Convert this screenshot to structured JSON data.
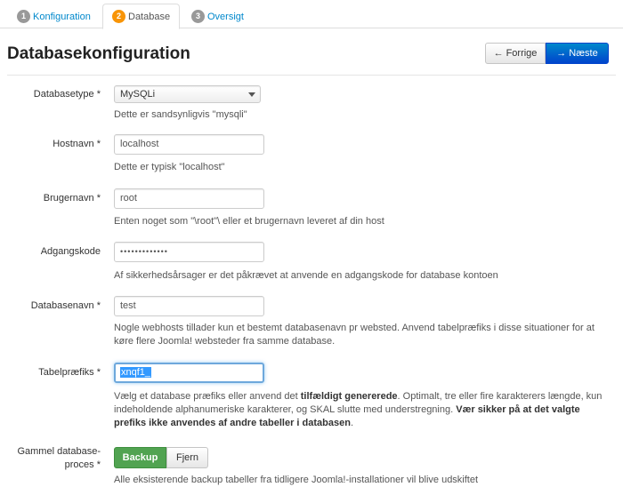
{
  "tabs": [
    {
      "num": "1",
      "label": "Konfiguration"
    },
    {
      "num": "2",
      "label": "Database"
    },
    {
      "num": "3",
      "label": "Oversigt"
    }
  ],
  "header": {
    "title": "Databasekonfiguration",
    "prev_label": "Forrige",
    "next_label": "Næste",
    "prev_icon": "←",
    "next_icon": "→"
  },
  "form": {
    "db_type": {
      "label": "Databasetype *",
      "value": "MySQLi",
      "help": "Dette er sandsynligvis \"mysqli\""
    },
    "host": {
      "label": "Hostnavn *",
      "value": "localhost",
      "help": "Dette er typisk \"localhost\""
    },
    "user": {
      "label": "Brugernavn *",
      "value": "root",
      "help": "Enten noget som \"\\root\"\\ eller et brugernavn leveret af din host"
    },
    "password": {
      "label": "Adgangskode",
      "value": "•••••••••••••",
      "help": "Af sikkerhedsårsager er det påkrævet at anvende en adgangskode for database kontoen"
    },
    "db_name": {
      "label": "Databasenavn *",
      "value": "test",
      "help_line1": "Nogle webhosts tillader kun et bestemt databasenavn pr websted. Anvend tabelpræfiks i disse situationer for at",
      "help_line2": "køre flere Joomla! websteder fra samme database."
    },
    "prefix": {
      "label": "Tabelpræfiks *",
      "value": "xnqf1_",
      "help_a": "Vælg et database præfiks eller anvend det ",
      "help_b": "tilfældigt genererede",
      "help_c": ". Optimalt, tre eller fire karakterers længde, kun",
      "help_d": "indeholdende alphanumeriske karakterer, og SKAL slutte med understregning. ",
      "help_e": "Vær sikker på at det valgte",
      "help_f": "prefiks ikke anvendes af andre tabeller i databasen",
      "help_g": "."
    },
    "old_db": {
      "label_line1": "Gammel database-",
      "label_line2": "proces *",
      "on_label": "Backup",
      "off_label": "Fjern",
      "help": "Alle eksisterende backup tabeller fra tidligere Joomla!-installationer vil blive udskiftet"
    }
  },
  "colors": {
    "accent": "#0088cc",
    "active_step": "#f89406",
    "toggle_on": "#51a351"
  }
}
